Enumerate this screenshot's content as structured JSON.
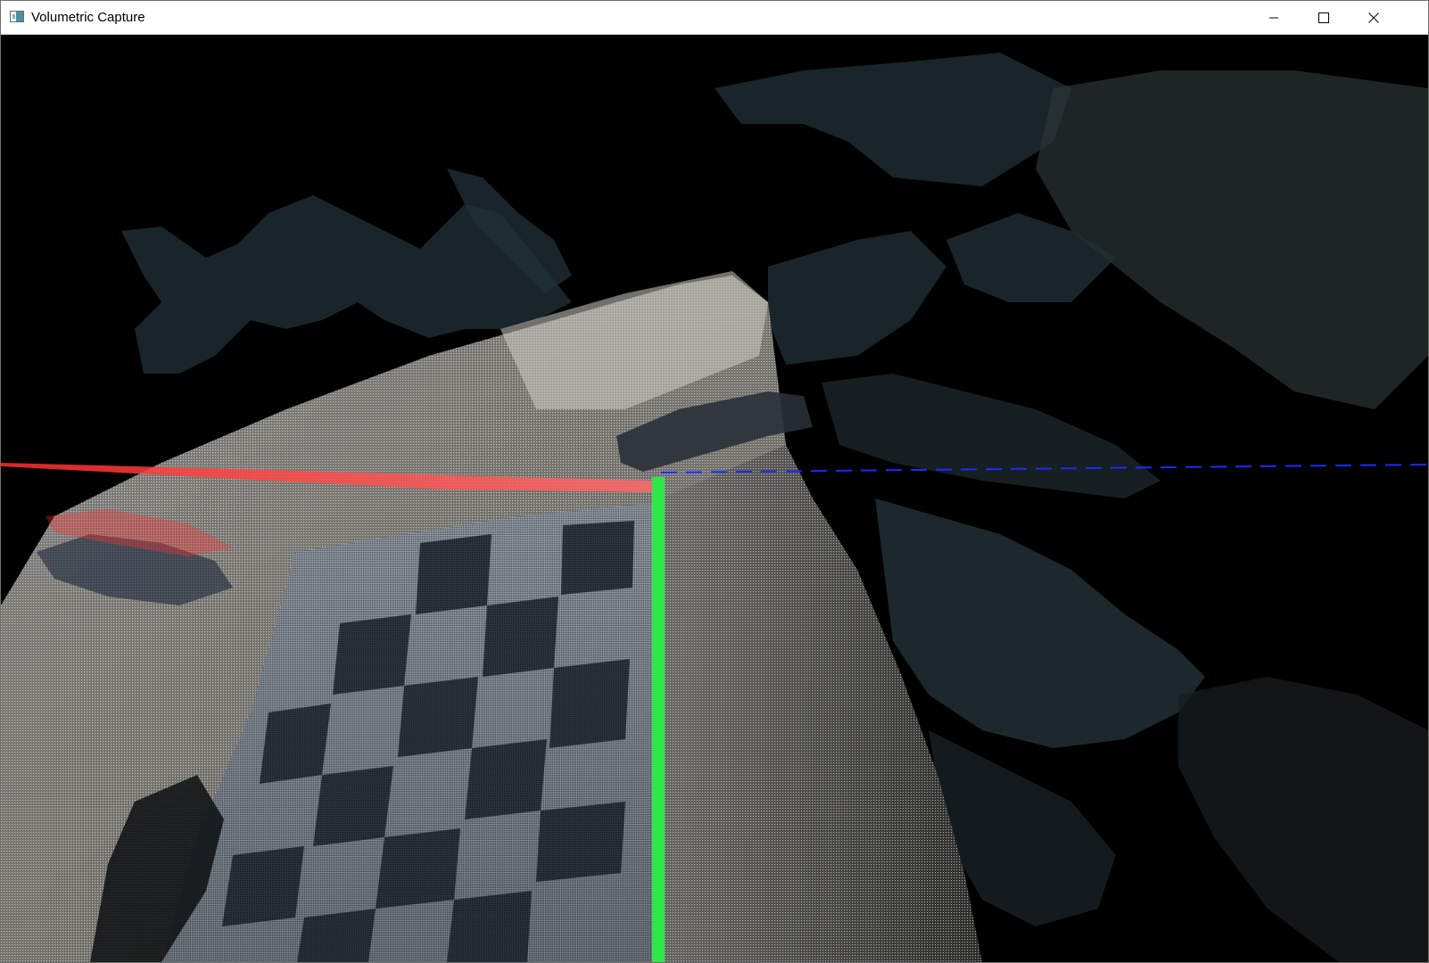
{
  "window": {
    "title": "Volumetric Capture",
    "app_icon": "app-window-icon",
    "controls": {
      "minimize_icon": "minimize-icon",
      "maximize_icon": "maximize-icon",
      "close_icon": "close-icon"
    }
  },
  "viewport": {
    "content": "3d-point-cloud",
    "axes": {
      "x_axis_color": "#ff2d2d",
      "y_axis_color": "#2ee84a",
      "z_axis_color": "#1a2cff"
    },
    "colors": {
      "background": "#000000",
      "surface_light": "#bdbab4",
      "surface_shadow": "#5c6a78",
      "checker_dark": "#1c2530",
      "foliage": "#2a3a40"
    }
  }
}
